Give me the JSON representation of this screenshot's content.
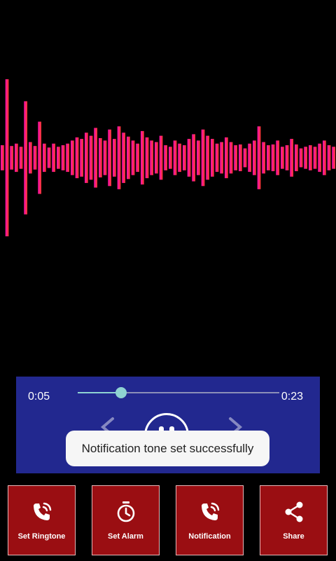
{
  "colors": {
    "wave_start": "#ff0db4",
    "wave_end": "#ff3a2a",
    "player_bg": "#22288f",
    "accent": "#8fd3d2",
    "action_bg": "#9a0e12"
  },
  "player": {
    "current_time": "0:05",
    "total_time": "0:23",
    "progress": 0.217,
    "state": "playing"
  },
  "toast": {
    "message": "Notification tone set successfully"
  },
  "actions": [
    {
      "label": "Set Ringtone",
      "icon": "phone-ring-icon"
    },
    {
      "label": "Set Alarm",
      "icon": "timer-icon"
    },
    {
      "label": "Notification",
      "icon": "phone-ring-icon"
    },
    {
      "label": "Share",
      "icon": "share-icon"
    }
  ],
  "waveform": [
    0.16,
    1.0,
    0.15,
    0.18,
    0.14,
    0.72,
    0.2,
    0.15,
    0.46,
    0.18,
    0.13,
    0.18,
    0.14,
    0.16,
    0.18,
    0.22,
    0.26,
    0.24,
    0.32,
    0.28,
    0.38,
    0.25,
    0.22,
    0.36,
    0.24,
    0.4,
    0.32,
    0.27,
    0.22,
    0.18,
    0.34,
    0.26,
    0.22,
    0.2,
    0.28,
    0.16,
    0.14,
    0.22,
    0.18,
    0.16,
    0.24,
    0.3,
    0.22,
    0.36,
    0.28,
    0.24,
    0.18,
    0.2,
    0.26,
    0.2,
    0.16,
    0.17,
    0.12,
    0.18,
    0.22,
    0.4,
    0.2,
    0.16,
    0.17,
    0.22,
    0.14,
    0.16,
    0.24,
    0.17,
    0.12,
    0.14,
    0.16,
    0.14,
    0.18,
    0.22,
    0.16,
    0.14
  ]
}
